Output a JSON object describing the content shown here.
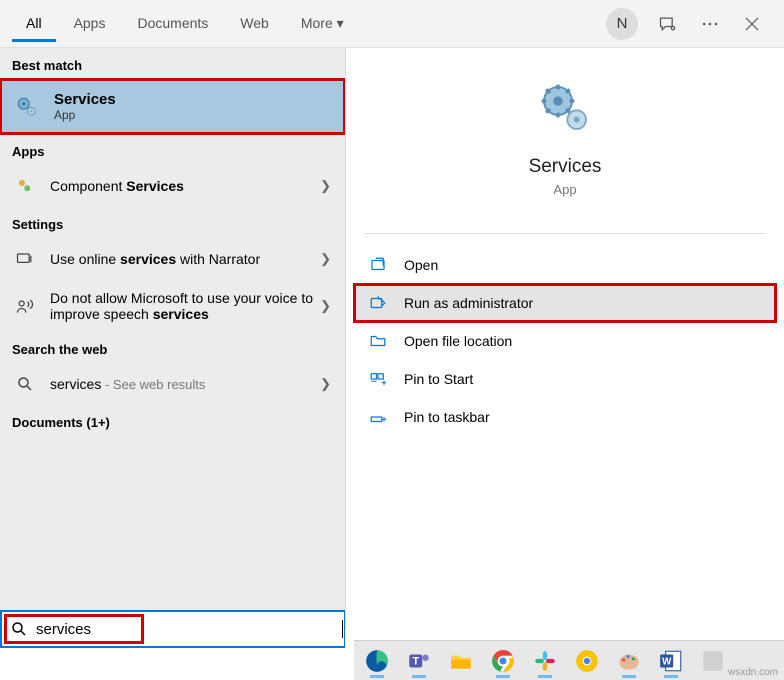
{
  "tabs": {
    "all": "All",
    "apps": "Apps",
    "documents": "Documents",
    "web": "Web",
    "more": "More"
  },
  "user_initial": "N",
  "sections": {
    "best_match": "Best match",
    "apps": "Apps",
    "settings": "Settings",
    "search_web": "Search the web",
    "documents": "Documents (1+)"
  },
  "best_match": {
    "title": "Services",
    "sub": "App"
  },
  "apps_result_prefix": "Component ",
  "apps_result_bold": "Services",
  "setting1_prefix": "Use online ",
  "setting1_bold": "services",
  "setting1_suffix": " with Narrator",
  "setting2_prefix": "Do not allow Microsoft to use your voice to improve speech ",
  "setting2_bold": "services",
  "web_query": "services",
  "web_suffix": " - See web results",
  "detail": {
    "title": "Services",
    "sub": "App"
  },
  "actions": {
    "open": "Open",
    "run_admin": "Run as administrator",
    "open_loc": "Open file location",
    "pin_start": "Pin to Start",
    "pin_taskbar": "Pin to taskbar"
  },
  "search_value": "services",
  "watermark": "wsxdn.com"
}
